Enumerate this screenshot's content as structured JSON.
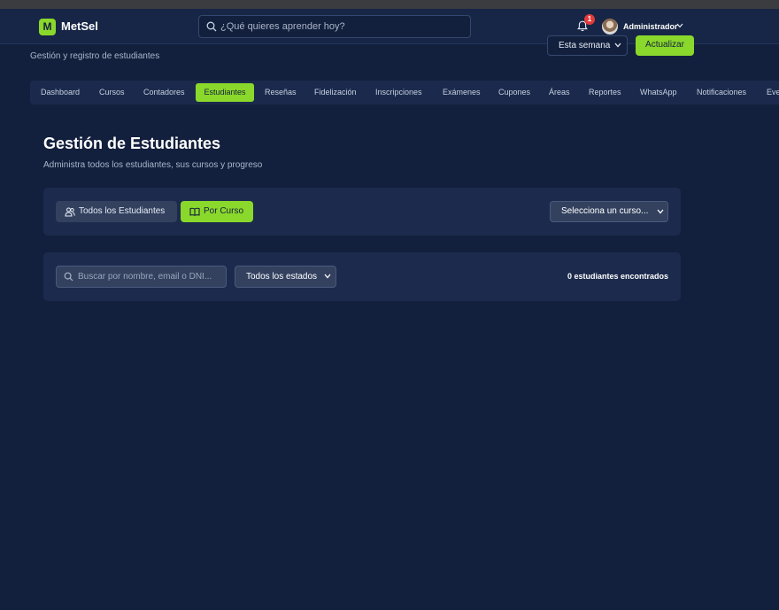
{
  "app": {
    "logo_letter": "M",
    "name": "MetSel"
  },
  "search": {
    "placeholder": "¿Qué quieres aprender hoy?"
  },
  "notifications": {
    "count": "1"
  },
  "user": {
    "name": "Administrador"
  },
  "header": {
    "subtitle": "Gestión y registro de estudiantes",
    "period_select": "Esta semana",
    "refresh_label": "Actualizar"
  },
  "nav": {
    "items": [
      {
        "label": "Dashboard",
        "active": false
      },
      {
        "label": "Cursos",
        "active": false
      },
      {
        "label": "Contadores",
        "active": false
      },
      {
        "label": "Estudiantes",
        "active": true
      },
      {
        "label": "Reseñas",
        "active": false
      },
      {
        "label": "Fidelización",
        "active": false
      },
      {
        "label": "Inscripciones",
        "active": false
      },
      {
        "label": "Exámenes",
        "active": false
      },
      {
        "label": "Cupones",
        "active": false
      },
      {
        "label": "Áreas",
        "active": false
      },
      {
        "label": "Reportes",
        "active": false
      },
      {
        "label": "WhatsApp",
        "active": false
      },
      {
        "label": "Notificaciones",
        "active": false
      },
      {
        "label": "Eve",
        "active": false
      }
    ]
  },
  "page": {
    "title": "Gestión de Estudiantes",
    "subtitle": "Administra todos los estudiantes, sus cursos y progreso"
  },
  "view_tabs": {
    "all_label": "Todos los Estudiantes",
    "by_course_label": "Por Curso",
    "active": "by_course"
  },
  "course_select": {
    "value": "Selecciona un curso..."
  },
  "filters": {
    "search_placeholder": "Buscar por nombre, email o DNI...",
    "state_select": "Todos los estados",
    "result_count": "0 estudiantes encontrados"
  },
  "colors": {
    "accent": "#8ad82b",
    "background": "#13203d",
    "card": "#1c2b4d",
    "badge": "#e23b3b"
  }
}
